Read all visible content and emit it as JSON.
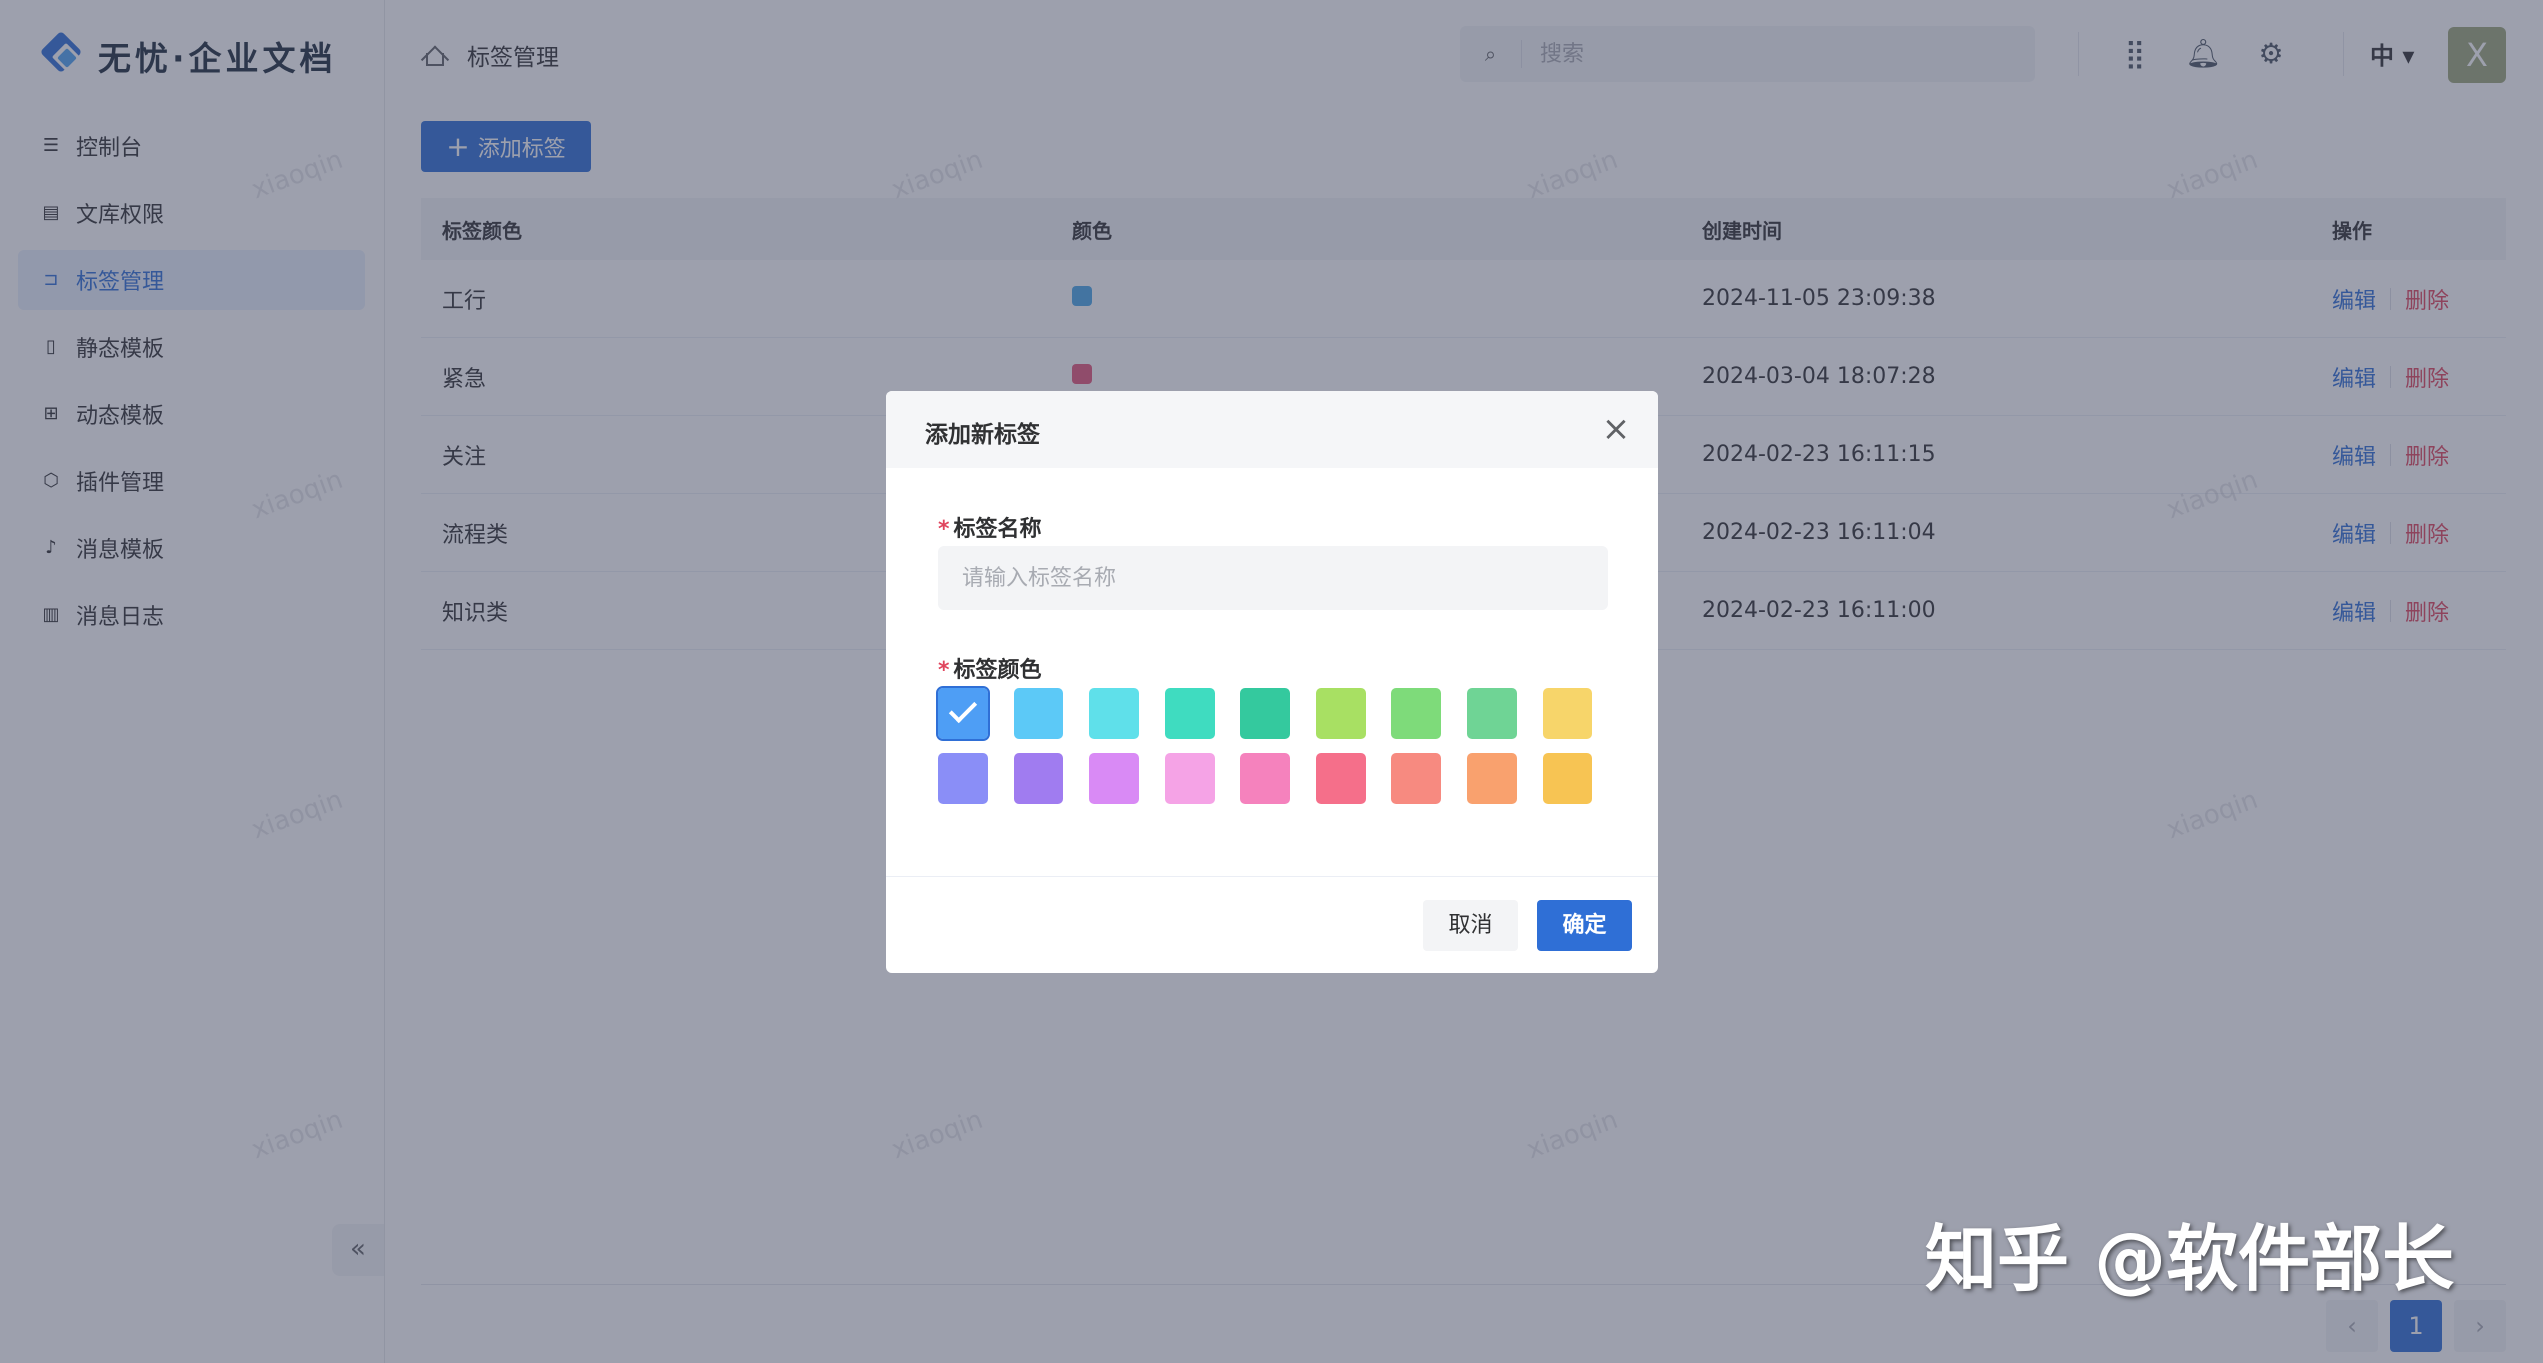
{
  "logo": {
    "text": "无忧·企业文档"
  },
  "sidebar": {
    "items": [
      {
        "label": "控制台",
        "icon": "sliders-icon",
        "glyph": "☰"
      },
      {
        "label": "文库权限",
        "icon": "chart-icon",
        "glyph": "▤"
      },
      {
        "label": "标签管理",
        "icon": "bookmark-icon",
        "glyph": "⊐",
        "active": true
      },
      {
        "label": "静态模板",
        "icon": "layout-icon",
        "glyph": "▯"
      },
      {
        "label": "动态模板",
        "icon": "grid-icon",
        "glyph": "⊞"
      },
      {
        "label": "插件管理",
        "icon": "puzzle-icon",
        "glyph": "⬡"
      },
      {
        "label": "消息模板",
        "icon": "bell-icon",
        "glyph": "♪"
      },
      {
        "label": "消息日志",
        "icon": "document-icon",
        "glyph": "▥"
      }
    ],
    "collapse_glyph": "«"
  },
  "header": {
    "breadcrumb": "标签管理",
    "search_placeholder": "搜索",
    "lang": "中 ▾",
    "avatar": "X"
  },
  "main": {
    "add_button": "添加标签",
    "columns": [
      "标签颜色",
      "颜色",
      "创建时间",
      "操作"
    ],
    "rows": [
      {
        "name": "工行",
        "color": "#4aa6e6",
        "time": "2024-11-05 23:09:38"
      },
      {
        "name": "紧急",
        "color": "#e5577a",
        "time": "2024-03-04 18:07:28"
      },
      {
        "name": "关注",
        "color": "",
        "time": "2024-02-23 16:11:15"
      },
      {
        "name": "流程类",
        "color": "",
        "time": "2024-02-23 16:11:04"
      },
      {
        "name": "知识类",
        "color": "",
        "time": "2024-02-23 16:11:00"
      }
    ],
    "edit_label": "编辑",
    "delete_label": "删除",
    "current_page": "1",
    "prev_glyph": "‹",
    "next_glyph": "›"
  },
  "watermark": "xiaoqin",
  "dialog": {
    "title": "添加新标签",
    "name_label": "标签名称",
    "name_placeholder": "请输入标签名称",
    "color_label": "标签颜色",
    "colors_row1": [
      "#4e9ef5",
      "#5cc9f7",
      "#5fe0ea",
      "#3fdcc0",
      "#34c99e",
      "#a8e063",
      "#7edb7a",
      "#6fd495",
      "#f7d56a"
    ],
    "colors_row2": [
      "#8a8ef7",
      "#a07cf0",
      "#d98af5",
      "#f5a3e6",
      "#f582bd",
      "#f56f8a",
      "#f78a80",
      "#f9a16e",
      "#f7c453"
    ],
    "selected_index": 0,
    "cancel": "取消",
    "ok": "确定"
  },
  "corner_watermark": "知乎 @软件部长"
}
